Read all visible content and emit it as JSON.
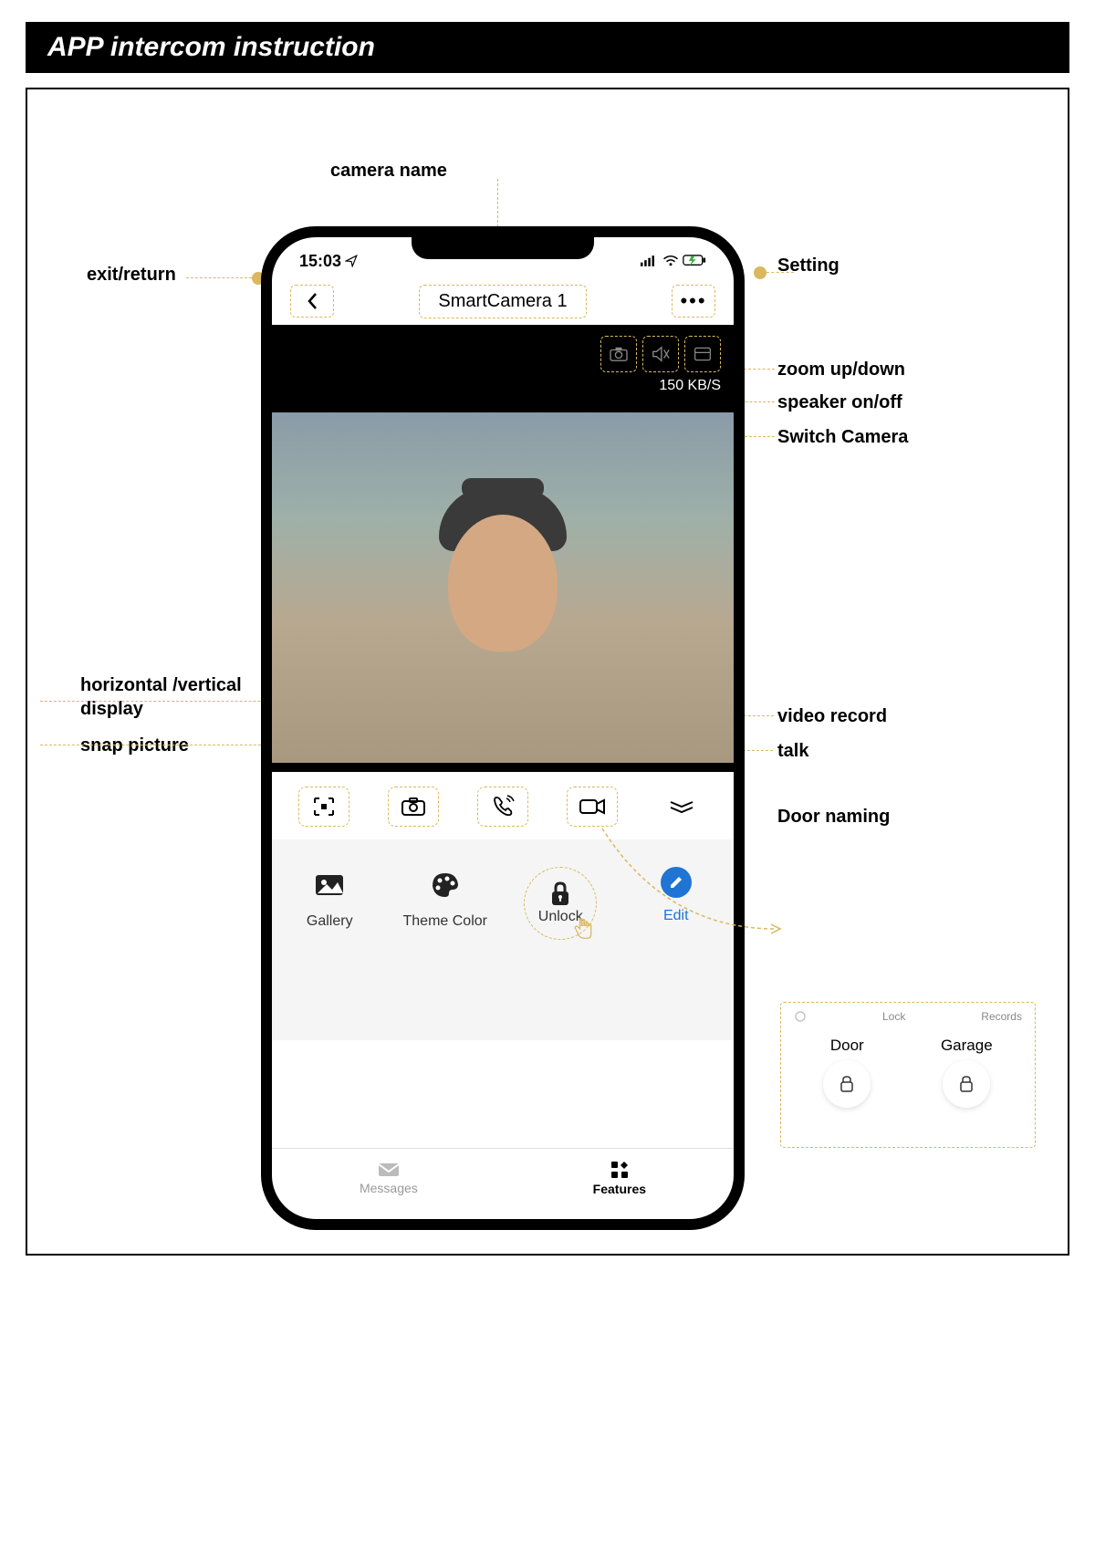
{
  "title": "APP intercom instruction",
  "status": {
    "time": "15:03"
  },
  "nav": {
    "camera_name": "SmartCamera 1"
  },
  "video": {
    "bitrate": "150 KB/S"
  },
  "grid": {
    "gallery": "Gallery",
    "theme": "Theme Color",
    "unlock": "Unlock",
    "edit": "Edit"
  },
  "tabs": {
    "messages": "Messages",
    "features": "Features"
  },
  "callouts": {
    "camera_name": "camera name",
    "exit": "exit/return",
    "setting": "Setting",
    "zoom": "zoom up/down",
    "speaker": "speaker on/off",
    "switch_cam": "Switch Camera",
    "display": "horizontal /vertical display",
    "snap": "snap picture",
    "record": "video record",
    "talk": "talk",
    "door_naming": "Door naming"
  },
  "door": {
    "tab_lock": "Lock",
    "tab_records": "Records",
    "door1": "Door",
    "door2": "Garage"
  }
}
